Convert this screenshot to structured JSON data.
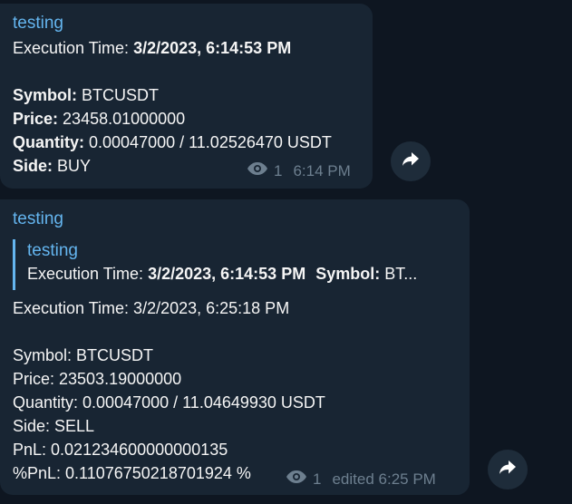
{
  "messages": [
    {
      "sender": "testing",
      "exec_label": "Execution Time:",
      "exec_value": "3/2/2023, 6:14:53 PM",
      "symbol_label": "Symbol:",
      "symbol_value": "BTCUSDT",
      "price_label": "Price:",
      "price_value": "23458.01000000",
      "quantity_label": "Quantity:",
      "quantity_value": "0.00047000 / 11.02526470 USDT",
      "side_label": "Side:",
      "side_value": "BUY",
      "views": "1",
      "time": "6:14 PM"
    },
    {
      "sender": "testing",
      "reply": {
        "sender": "testing",
        "exec_label": "Execution Time:",
        "exec_value": "3/2/2023, 6:14:53 PM",
        "symbol_label": "Symbol:",
        "symbol_value": "BT..."
      },
      "exec_line": "Execution Time: 3/2/2023, 6:25:18 PM",
      "symbol_line": "Symbol: BTCUSDT",
      "price_line": "Price: 23503.19000000",
      "quantity_line": "Quantity: 0.00047000 / 11.04649930 USDT",
      "side_line": "Side: SELL",
      "pnl_line": "PnL:  0.021234600000000135",
      "pct_pnl_line": "%PnL: 0.11076750218701924 %",
      "views": "1",
      "time": "edited 6:25 PM"
    }
  ],
  "icons": {
    "views": "eye-icon",
    "share": "share-icon"
  },
  "colors": {
    "background": "#0e1621",
    "bubble": "#182533",
    "accent": "#64b5ef",
    "meta": "#6d7f8f"
  }
}
